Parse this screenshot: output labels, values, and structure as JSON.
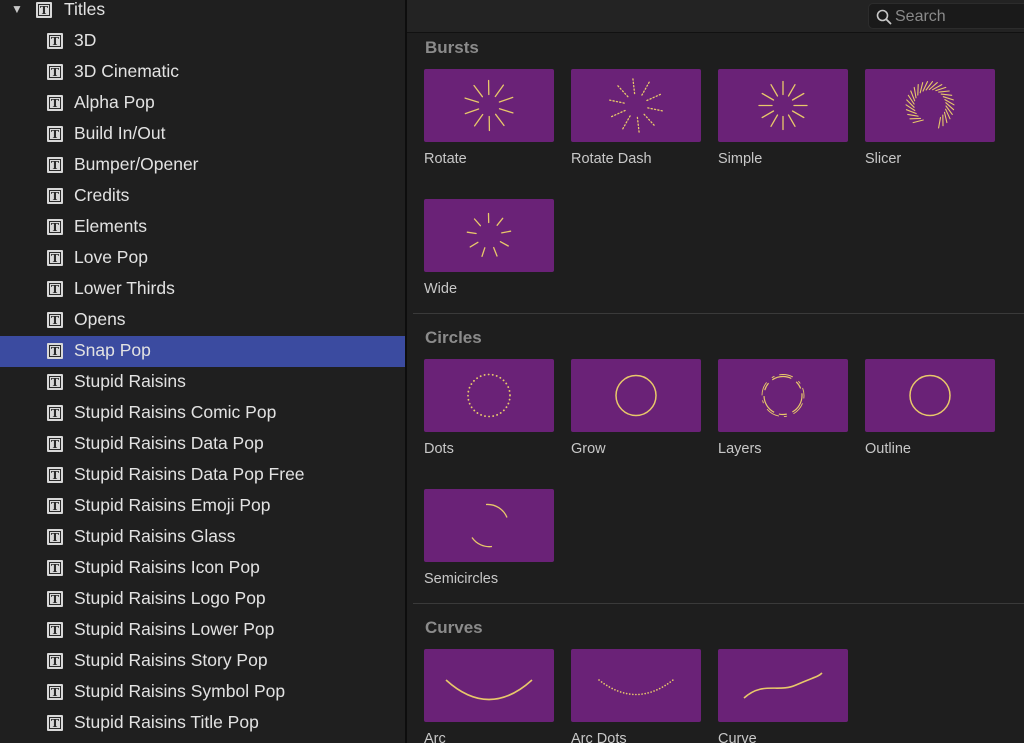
{
  "sidebar": {
    "root": {
      "label": "Titles",
      "icon": "title-icon",
      "expanded": true
    },
    "items": [
      {
        "label": "3D"
      },
      {
        "label": "3D Cinematic"
      },
      {
        "label": "Alpha Pop"
      },
      {
        "label": "Build In/Out"
      },
      {
        "label": "Bumper/Opener"
      },
      {
        "label": "Credits"
      },
      {
        "label": "Elements"
      },
      {
        "label": "Love Pop"
      },
      {
        "label": "Lower Thirds"
      },
      {
        "label": "Opens"
      },
      {
        "label": "Snap Pop",
        "selected": true
      },
      {
        "label": "Stupid Raisins"
      },
      {
        "label": "Stupid Raisins Comic Pop"
      },
      {
        "label": "Stupid Raisins Data Pop"
      },
      {
        "label": "Stupid Raisins Data Pop Free"
      },
      {
        "label": "Stupid Raisins Emoji Pop"
      },
      {
        "label": "Stupid Raisins Glass"
      },
      {
        "label": "Stupid Raisins Icon Pop"
      },
      {
        "label": "Stupid Raisins Logo Pop"
      },
      {
        "label": "Stupid Raisins Lower Pop"
      },
      {
        "label": "Stupid Raisins Story Pop"
      },
      {
        "label": "Stupid Raisins Symbol Pop"
      },
      {
        "label": "Stupid Raisins Title Pop"
      }
    ]
  },
  "search": {
    "placeholder": "Search",
    "value": ""
  },
  "sections": [
    {
      "title": "Bursts",
      "tiles": [
        {
          "label": "Rotate",
          "thumbnail": "burst-rotate"
        },
        {
          "label": "Rotate Dash",
          "thumbnail": "burst-rotate-dash"
        },
        {
          "label": "Simple",
          "thumbnail": "burst-simple"
        },
        {
          "label": "Slicer",
          "thumbnail": "burst-slicer"
        },
        {
          "label": "Wide",
          "thumbnail": "burst-wide"
        }
      ]
    },
    {
      "title": "Circles",
      "tiles": [
        {
          "label": "Dots",
          "thumbnail": "circle-dots"
        },
        {
          "label": "Grow",
          "thumbnail": "circle-grow"
        },
        {
          "label": "Layers",
          "thumbnail": "circle-layers"
        },
        {
          "label": "Outline",
          "thumbnail": "circle-outline"
        },
        {
          "label": "Semicircles",
          "thumbnail": "circle-semicircles"
        }
      ]
    },
    {
      "title": "Curves",
      "tiles": [
        {
          "label": "Arc",
          "thumbnail": "curve-arc"
        },
        {
          "label": "Arc Dots",
          "thumbnail": "curve-arc-dots"
        },
        {
          "label": "Curve",
          "thumbnail": "curve-curve"
        }
      ]
    }
  ],
  "colors": {
    "selection": "#3b4ba0",
    "thumbnail_bg": "#6a2277",
    "thumbnail_stroke": "#e8c86a"
  }
}
